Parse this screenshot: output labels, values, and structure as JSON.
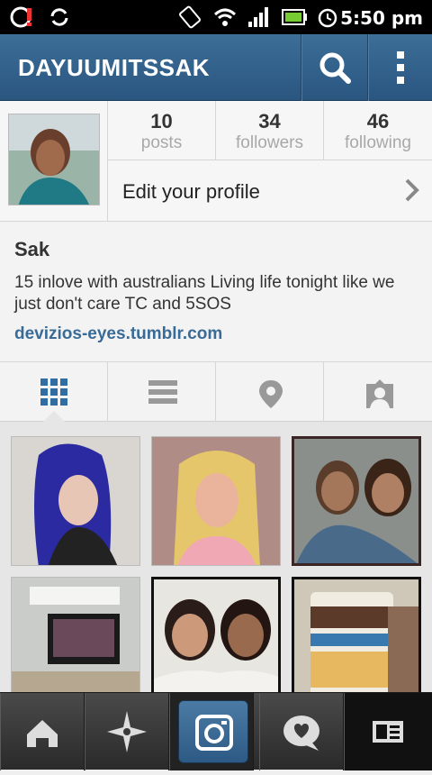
{
  "statusbar": {
    "time": "5:50 pm"
  },
  "header": {
    "username": "DAYUUMITSSAK"
  },
  "stats": [
    {
      "count": "10",
      "label": "posts"
    },
    {
      "count": "34",
      "label": "followers"
    },
    {
      "count": "46",
      "label": "following"
    }
  ],
  "edit_profile": {
    "label": "Edit your profile"
  },
  "bio": {
    "name": "Sak",
    "text": "15 inlove with australians  Living life tonight like we just don't care TC and 5SOS",
    "link": "devizios-eyes.tumblr.com"
  },
  "colors": {
    "accent": "#2f5d87",
    "link": "#3a6b96",
    "active_tab": "#2f6da3"
  },
  "icons": {
    "tabs": [
      "grid-icon",
      "list-icon",
      "location-pin-icon",
      "tagged-person-icon"
    ],
    "bottom": [
      "home-icon",
      "explore-star-icon",
      "camera-icon",
      "activity-heart-bubble-icon",
      "profile-card-icon"
    ]
  }
}
